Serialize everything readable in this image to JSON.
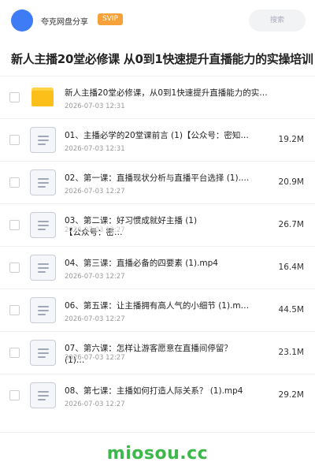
{
  "header": {
    "share_title": "夸克网盘分享",
    "svip_badge": "SVIP",
    "search_label": "搜索",
    "accent_color": "#3d7cf5",
    "badge_color": "#f7a238"
  },
  "page": {
    "title": "新人主播20堂必修课 从0到1快速提升直播能力的实操培训"
  },
  "files": [
    {
      "type": "folder",
      "name": "新人主播20堂必修课，从0到1快速提升直播能力的实…",
      "date": "2026-07-03 12:31",
      "size": "",
      "icon": "folder-icon"
    },
    {
      "type": "file",
      "name": "01、主播必学的20堂课前言 (1)【公众号：密知…",
      "date": "2026-07-03 12:31",
      "size": "19.2M",
      "icon": "document-icon"
    },
    {
      "type": "file",
      "name": "02、第一课：直播现状分析与直播平台选择 (1).…",
      "date": "2026-07-03 12:27",
      "size": "20.9M",
      "icon": "document-icon"
    },
    {
      "type": "file",
      "name": "03、第二课：好习惯成就好主播 (1)【公众号：密…",
      "date": "2026-07-03 12:27",
      "size": "26.7M",
      "icon": "document-icon"
    },
    {
      "type": "file",
      "name": "04、第三课：直播必备的四要素 (1).mp4",
      "date": "2026-07-03 12:27",
      "size": "16.4M",
      "icon": "document-icon"
    },
    {
      "type": "file",
      "name": "06、第五课：让主播拥有高人气的小细节 (1).m…",
      "date": "2026-07-03 12:27",
      "size": "44.5M",
      "icon": "document-icon"
    },
    {
      "type": "file",
      "name": "07、第六课：怎样让游客愿意在直播间停留？ (1)…",
      "date": "2026-07-03 12:27",
      "size": "23.1M",
      "icon": "document-icon"
    },
    {
      "type": "file",
      "name": "08、第七课：主播如何打造人际关系？ (1).mp4",
      "date": "2026-07-03 12:27",
      "size": "29.2M",
      "icon": "document-icon"
    }
  ],
  "watermark": "miosou.cc"
}
